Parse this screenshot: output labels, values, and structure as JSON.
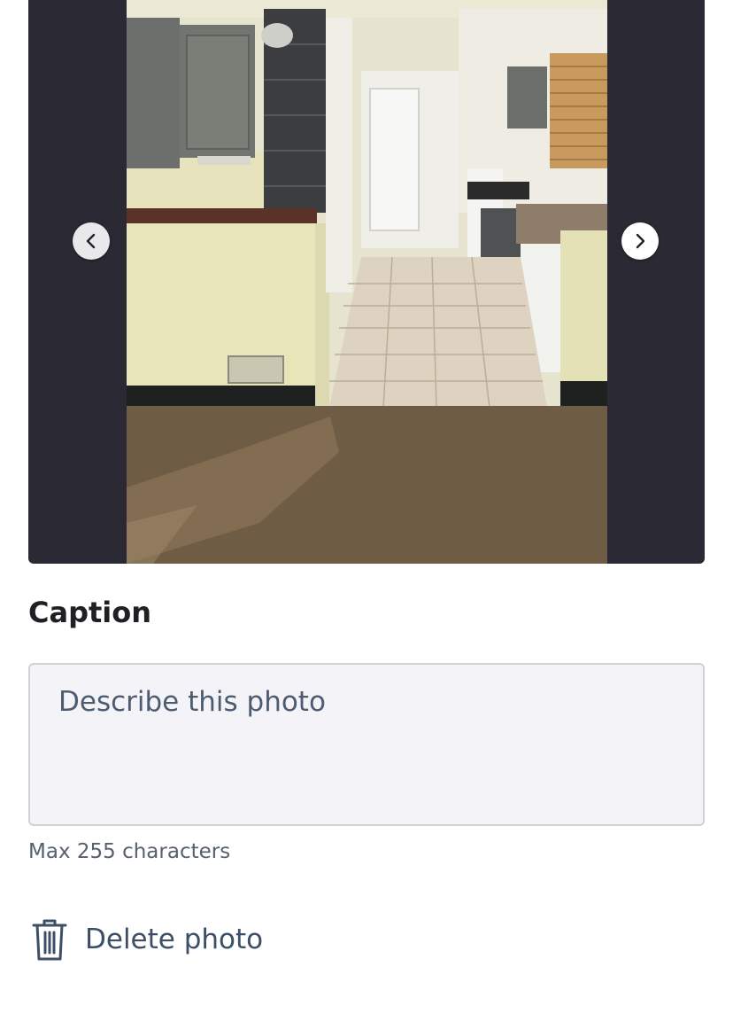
{
  "photo_viewer": {
    "photo_alt": "Kitchen and hallway with carpeted floor",
    "prev_icon": "chevron-left-icon",
    "next_icon": "chevron-right-icon"
  },
  "caption": {
    "title": "Caption",
    "placeholder": "Describe this photo",
    "value": "",
    "hint": "Max 255 characters"
  },
  "actions": {
    "delete_label": "Delete photo",
    "delete_icon": "trash-icon"
  },
  "colors": {
    "viewer_background": "#2b2a34",
    "link_text": "#3c4f66",
    "input_background": "#f4f4f8"
  }
}
